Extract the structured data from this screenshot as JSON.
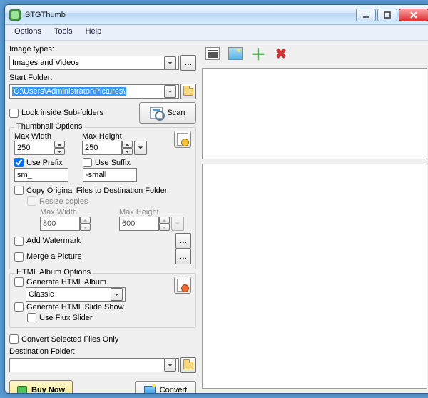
{
  "window": {
    "title": "STGThumb"
  },
  "menu": {
    "options": "Options",
    "tools": "Tools",
    "help": "Help"
  },
  "labels": {
    "image_types": "Image types:",
    "start_folder": "Start Folder:",
    "look_inside": "Look inside Sub-folders",
    "scan": "Scan",
    "thumb_options": "Thumbnail Options",
    "max_width": "Max Width",
    "max_height": "Max Height",
    "use_prefix": "Use Prefix",
    "use_suffix": "Use Suffix",
    "copy_orig": "Copy Original Files to Destination Folder",
    "resize_copies": "Resize copies",
    "add_watermark": "Add Watermark",
    "merge_picture": "Merge a Picture",
    "html_options": "HTML Album Options",
    "gen_album": "Generate HTML Album",
    "gen_slide": "Generate HTML Slide Show",
    "use_flux": "Use Flux Slider",
    "convert_selected": "Convert Selected Files Only",
    "dest_folder": "Destination Folder:",
    "buy_now": "Buy Now",
    "convert": "Convert"
  },
  "values": {
    "image_types": "Images and Videos",
    "start_folder": "C:\\Users\\Administrator\\Pictures\\",
    "thumb_max_w": "250",
    "thumb_max_h": "250",
    "prefix": "sm_",
    "suffix": "-small",
    "copy_max_w": "800",
    "copy_max_h": "600",
    "album_style": "Classic",
    "dest_folder": ""
  },
  "checks": {
    "look_inside": false,
    "use_prefix": true,
    "use_suffix": false,
    "copy_orig": false,
    "resize_copies": false,
    "add_watermark": false,
    "merge_picture": false,
    "gen_album": false,
    "gen_slide": false,
    "use_flux": false,
    "convert_selected": false
  }
}
